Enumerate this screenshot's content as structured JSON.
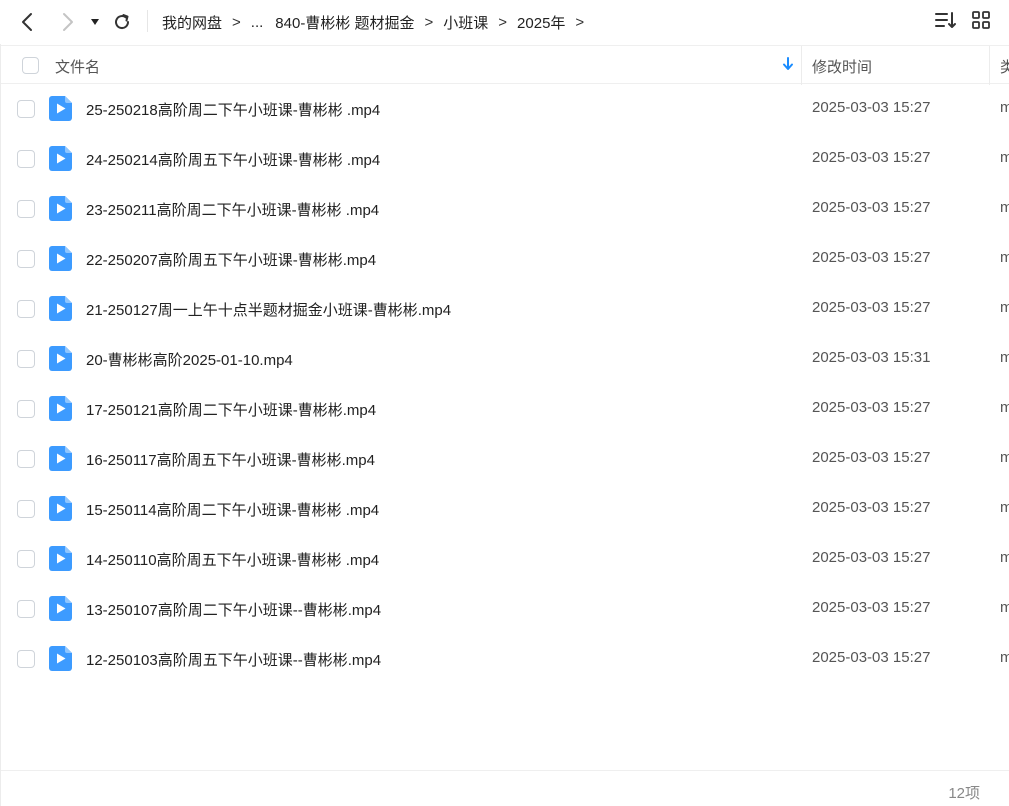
{
  "toolbar": {
    "back_icon": "chevron-left-icon",
    "forward_icon": "chevron-right-icon",
    "history_icon": "caret-down-icon",
    "refresh_icon": "refresh-icon",
    "sort_icon": "sort-list-icon",
    "view_icon": "grid-view-icon"
  },
  "breadcrumb": {
    "items": [
      "我的网盘",
      "...",
      "840-曹彬彬 题材掘金",
      "小班课",
      "2025年"
    ],
    "separator": ">"
  },
  "header": {
    "name_label": "文件名",
    "mtime_label": "修改时间",
    "type_label": "类",
    "sort_arrow_color": "#1a8cff"
  },
  "files": [
    {
      "name": "25-250218高阶周二下午小班课-曹彬彬 .mp4",
      "mtime": "2025-03-03 15:27",
      "type": "m"
    },
    {
      "name": "24-250214高阶周五下午小班课-曹彬彬 .mp4",
      "mtime": "2025-03-03 15:27",
      "type": "m"
    },
    {
      "name": "23-250211高阶周二下午小班课-曹彬彬 .mp4",
      "mtime": "2025-03-03 15:27",
      "type": "m"
    },
    {
      "name": "22-250207高阶周五下午小班课-曹彬彬.mp4",
      "mtime": "2025-03-03 15:27",
      "type": "m"
    },
    {
      "name": "21-250127周一上午十点半题材掘金小班课-曹彬彬.mp4",
      "mtime": "2025-03-03 15:27",
      "type": "m"
    },
    {
      "name": "20-曹彬彬高阶2025-01-10.mp4",
      "mtime": "2025-03-03 15:31",
      "type": "m"
    },
    {
      "name": "17-250121高阶周二下午小班课-曹彬彬.mp4",
      "mtime": "2025-03-03 15:27",
      "type": "m"
    },
    {
      "name": "16-250117高阶周五下午小班课-曹彬彬.mp4",
      "mtime": "2025-03-03 15:27",
      "type": "m"
    },
    {
      "name": "15-250114高阶周二下午小班课-曹彬彬 .mp4",
      "mtime": "2025-03-03 15:27",
      "type": "m"
    },
    {
      "name": "14-250110高阶周五下午小班课-曹彬彬 .mp4",
      "mtime": "2025-03-03 15:27",
      "type": "m"
    },
    {
      "name": "13-250107高阶周二下午小班课--曹彬彬.mp4",
      "mtime": "2025-03-03 15:27",
      "type": "m"
    },
    {
      "name": "12-250103高阶周五下午小班课--曹彬彬.mp4",
      "mtime": "2025-03-03 15:27",
      "type": "m"
    }
  ],
  "file_icon": "video-file-icon",
  "file_icon_color": "#3d9bff",
  "footer": {
    "count_label": "12项"
  }
}
